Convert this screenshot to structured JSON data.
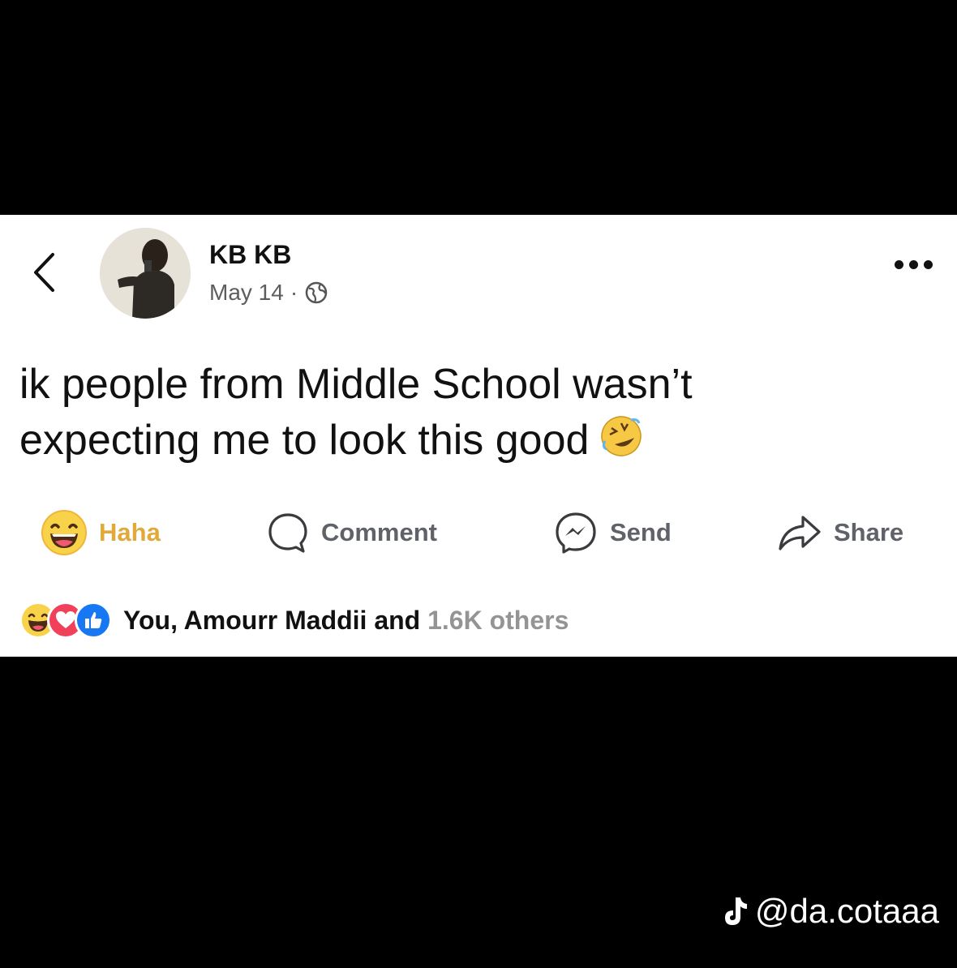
{
  "post": {
    "author_name": "KB KB",
    "date": "May 14",
    "separator": "·",
    "privacy_icon": "globe-icon",
    "text_line1": "ik people from Middle School wasn’t",
    "text_line2": "expecting me to look this good",
    "text_emoji": "rolling-on-floor-laughing-emoji"
  },
  "actions": {
    "haha_label": "Haha",
    "comment_label": "Comment",
    "send_label": "Send",
    "share_label": "Share"
  },
  "reactions": {
    "icons": [
      "haha-icon",
      "love-icon",
      "like-icon"
    ],
    "summary_text": "You, Amourr Maddii and",
    "summary_faded": "1.6K others"
  },
  "watermark": {
    "icon": "tiktok-icon",
    "handle": "@da.cotaaa"
  },
  "colors": {
    "haha_accent": "#e0a93a",
    "like_blue": "#1877f2",
    "love_red": "#f0405a",
    "action_gray": "#5f6268"
  }
}
